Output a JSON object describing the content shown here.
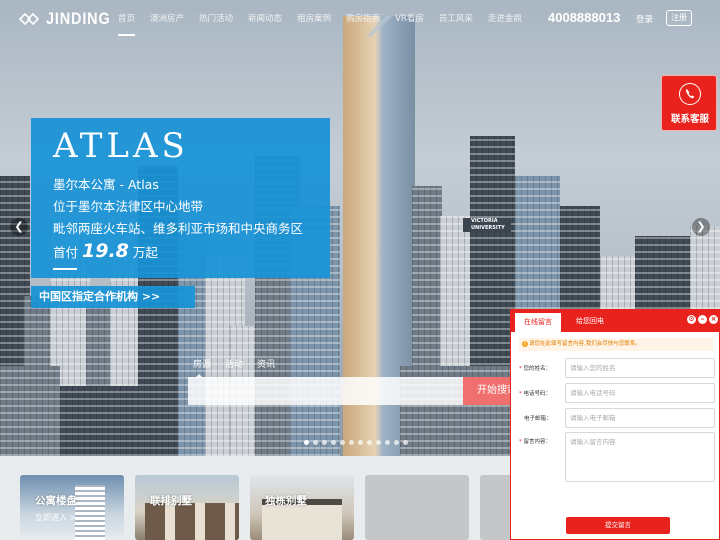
{
  "nav": {
    "logo_text": "JINDING",
    "menu": [
      "首页",
      "澳洲房产",
      "热门活动",
      "新闻动态",
      "租房案例",
      "购房指南",
      "VR看房",
      "员工风采",
      "走进金鼎"
    ],
    "phone": "4008888013",
    "login": "登录",
    "register": "注册"
  },
  "banner": {
    "title": "ATLAS",
    "line1": "墨尔本公寓 - Atlas",
    "line2": "位于墨尔本法律区中心地带",
    "line3": "毗邻两座火车站、维多利亚市场和中央商务区",
    "price_prefix": "首付",
    "price_value": "19.8",
    "price_suffix": "万起",
    "partner": "中国区指定合作机构 >>",
    "building_sign": "VICTORIA UNIVERSITY",
    "slide_count": 12,
    "active_slide": 0
  },
  "search": {
    "tabs": [
      "房源",
      "活动",
      "资讯"
    ],
    "active_tab": 0,
    "button": "开始搜索"
  },
  "categories": [
    {
      "name": "公寓楼盘",
      "sub": "立即进入 >"
    },
    {
      "name": "联排别墅",
      "sub": ""
    },
    {
      "name": "独栋别墅",
      "sub": ""
    },
    {
      "name": "",
      "sub": ""
    },
    {
      "name": "",
      "sub": ""
    }
  ],
  "service": {
    "label": "联系客服",
    "icon": "phone-icon"
  },
  "message_panel": {
    "tabs": [
      "在线留言",
      "给您回电"
    ],
    "notice": "请您在此填写留言内容,我们会尽快与您联系。",
    "fields": [
      {
        "label": "您的姓名：",
        "required": true,
        "placeholder": "请输入您的姓名"
      },
      {
        "label": "电话号码：",
        "required": true,
        "placeholder": "请输入电话号码"
      },
      {
        "label": "电子邮箱：",
        "required": false,
        "placeholder": "请输入电子邮箱"
      },
      {
        "label": "留言内容：",
        "required": true,
        "placeholder": "请输入留言内容"
      }
    ],
    "submit": "提交留言"
  },
  "colors": {
    "accent_red": "#e8231e",
    "banner_blue": "#1892d6",
    "search_button": "#f06f6f"
  }
}
